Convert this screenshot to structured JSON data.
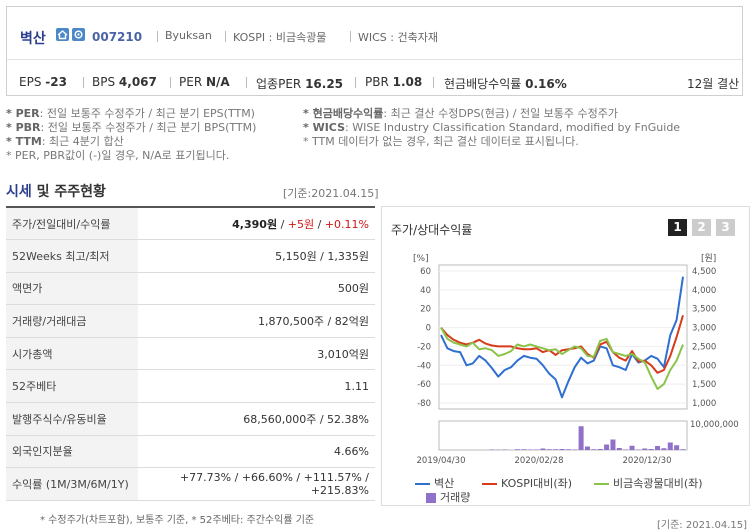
{
  "header": {
    "name": "벽산",
    "code": "007210",
    "english_name": "Byuksan",
    "market": "KOSPI : 비금속광물",
    "wics": "WICS : 건축자재",
    "indicators": [
      {
        "label": "EPS",
        "value": "-23"
      },
      {
        "label": "BPS",
        "value": "4,067"
      },
      {
        "label": "PER",
        "value": "N/A"
      },
      {
        "label": "업종PER",
        "value": "16.25"
      },
      {
        "label": "PBR",
        "value": "1.08"
      },
      {
        "label": "현금배당수익률",
        "value": "0.16%"
      }
    ],
    "settlement": "12월 결산"
  },
  "notes": {
    "left": [
      {
        "key": "* PER",
        "text": ": 전일 보통주 수정주가 / 최근 분기 EPS(TTM)"
      },
      {
        "key": "* PBR",
        "text": ": 전일 보통주 수정주가 / 최근 분기 BPS(TTM)"
      },
      {
        "key": "* TTM",
        "text": ": 최근 4분기 합산"
      },
      {
        "key": "",
        "text": "* PER, PBR값이 (-)일 경우, N/A로 표기됩니다."
      }
    ],
    "right": [
      {
        "key": "* 현금배당수익률",
        "text": ": 최근 결산 수정DPS(현금) / 전일 보통주 수정주가"
      },
      {
        "key": "* WICS",
        "text": ": WISE Industry Classification Standard, modified by FnGuide"
      },
      {
        "key": "",
        "text": "* TTM 데이터가 없는 경우, 최근 결산 데이터로 표시됩니다."
      }
    ]
  },
  "quote_section": {
    "title_highlight": "시세",
    "title_rest": " 및 주주현황",
    "date": "[기준:2021.04.15]",
    "rows": [
      {
        "label": "주가/전일대비/수익률",
        "value_main": "4,390원",
        "value_sep1": " / ",
        "value_red1": "+5원",
        "value_sep2": " / ",
        "value_red2": "+0.11%"
      },
      {
        "label": "52Weeks 최고/최저",
        "value": "5,150원 / 1,335원"
      },
      {
        "label": "액면가",
        "value": "500원"
      },
      {
        "label": "거래량/거래대금",
        "value": "1,870,500주 / 82억원"
      },
      {
        "label": "시가총액",
        "value": "3,010억원"
      },
      {
        "label": "52주베타",
        "value": "1.11"
      },
      {
        "label": "발행주식수/유동비율",
        "value": "68,560,000주 / 52.38%"
      },
      {
        "label": "외국인지분율",
        "value": "4.66%"
      },
      {
        "label": "수익률 (1M/3M/6M/1Y)",
        "value_red": "+77.73% / +66.60% / +111.57% / +215.83%"
      }
    ],
    "footnote": "* 수정주가(차트포함), 보통주 기준, * 52주베타: 주간수익률 기준"
  },
  "chart_section": {
    "title": "주가/상대수익률",
    "tabs": [
      "1",
      "2",
      "3"
    ],
    "footer_date": "[기준: 2021.04.15]"
  },
  "chart_data": {
    "type": "line",
    "left_unit": "[%]",
    "right_unit": "[원]",
    "y_left_ticks": [
      "60",
      "40",
      "20",
      "0",
      "-20",
      "-40",
      "-60",
      "-80"
    ],
    "y_right_ticks": [
      "4,500",
      "4,000",
      "3,500",
      "3,000",
      "2,500",
      "2,000",
      "1,500",
      "1,000"
    ],
    "volume_tick": "10,000,000",
    "x_ticks": [
      "2019/04/30",
      "2020/02/28",
      "2020/12/30"
    ],
    "ylim_left": [
      -80,
      60
    ],
    "ylim_volume": [
      0,
      10000000
    ],
    "series": [
      {
        "name": "벽산",
        "color": "#2f6fd0",
        "values": [
          -8,
          -22,
          -25,
          -26,
          -40,
          -38,
          -30,
          -35,
          -43,
          -52,
          -45,
          -42,
          -35,
          -30,
          -32,
          -33,
          -40,
          -49,
          -55,
          -74,
          -57,
          -42,
          -32,
          -38,
          -35,
          -20,
          -22,
          -40,
          -42,
          -45,
          -28,
          -37,
          -35,
          -30,
          -33,
          -42,
          -8,
          8,
          54
        ]
      },
      {
        "name": "KOSPI대비(좌)",
        "color": "#d83b1c",
        "values": [
          0,
          -8,
          -13,
          -16,
          -18,
          -16,
          -13,
          -17,
          -19,
          -20,
          -20,
          -20,
          -22,
          -23,
          -23,
          -22,
          -26,
          -24,
          -29,
          -24,
          -23,
          -22,
          -20,
          -28,
          -32,
          -18,
          -15,
          -26,
          -32,
          -35,
          -25,
          -36,
          -35,
          -40,
          -48,
          -45,
          -30,
          -10,
          13
        ]
      },
      {
        "name": "비금속광물대비(좌)",
        "color": "#8bc34a",
        "values": [
          0,
          -12,
          -16,
          -18,
          -20,
          -16,
          -23,
          -22,
          -24,
          -30,
          -28,
          -25,
          -18,
          -20,
          -18,
          -20,
          -22,
          -24,
          -23,
          -28,
          -24,
          -20,
          -22,
          -30,
          -31,
          -14,
          -12,
          -26,
          -28,
          -30,
          -28,
          -33,
          -37,
          -52,
          -65,
          -60,
          -45,
          -35,
          -18
        ]
      },
      {
        "name": "거래량",
        "color": "#8f71c9",
        "values": [
          0,
          0,
          0,
          0,
          0,
          0,
          0,
          0,
          200000,
          100000,
          200000,
          0,
          300000,
          300000,
          200000,
          200000,
          600000,
          300000,
          300000,
          400000,
          300000,
          200000,
          9500000,
          1400000,
          300000,
          400000,
          2200000,
          4200000,
          800000,
          200000,
          1700000,
          200000,
          600000,
          400000,
          1600000,
          700000,
          3000000,
          1900000,
          300000
        ]
      }
    ]
  }
}
